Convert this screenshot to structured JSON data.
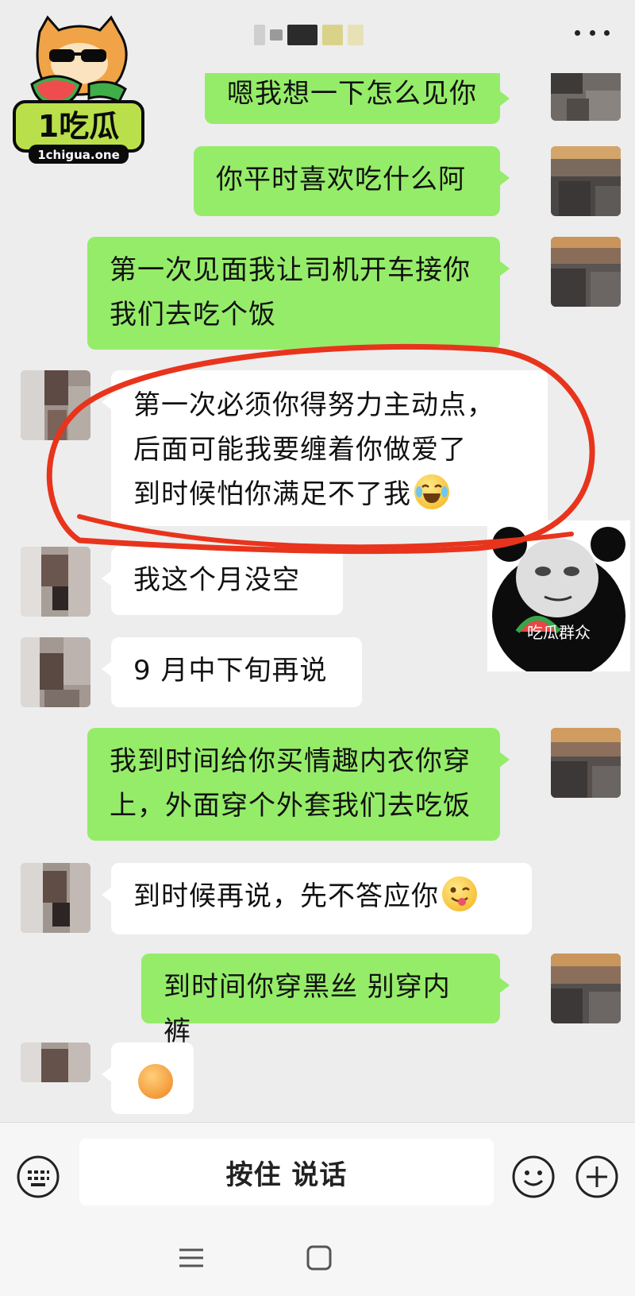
{
  "header": {
    "more_icon": "more-dots-icon"
  },
  "watermark": {
    "brand": "1吃瓜",
    "domain": "1chigua.one"
  },
  "colors": {
    "sent_bubble": "#95ec69",
    "received_bubble": "#ffffff",
    "background": "#ededed",
    "highlight_circle": "#e8341c"
  },
  "messages": [
    {
      "side": "me",
      "text": "嗯我想一下怎么见你"
    },
    {
      "side": "me",
      "text": "你平时喜欢吃什么阿"
    },
    {
      "side": "me",
      "line1": "第一次见面我让司机开车接你",
      "line2": "我们去吃个饭"
    },
    {
      "side": "other",
      "line1": "第一次必须你得努力主动点，",
      "line2": "后面可能我要缠着你做爱了",
      "line3": "到时候怕你满足不了我",
      "emoji": "tears-of-joy-emoji"
    },
    {
      "side": "other",
      "text": "我这个月没空"
    },
    {
      "side": "other",
      "text": "9 月中下旬再说"
    },
    {
      "side": "me",
      "line1": "我到时间给你买情趣内衣你穿",
      "line2": "上，外面穿个外套我们去吃饭"
    },
    {
      "side": "other",
      "text": "到时候再说，先不答应你",
      "emoji": "winking-tongue-emoji"
    },
    {
      "side": "me",
      "text": "到时间你穿黑丝 别穿内裤"
    },
    {
      "side": "other",
      "emoji": "sweat-emoji"
    }
  ],
  "sticker": {
    "caption": "吃瓜群众"
  },
  "input": {
    "voice_label": "按住 说话"
  }
}
